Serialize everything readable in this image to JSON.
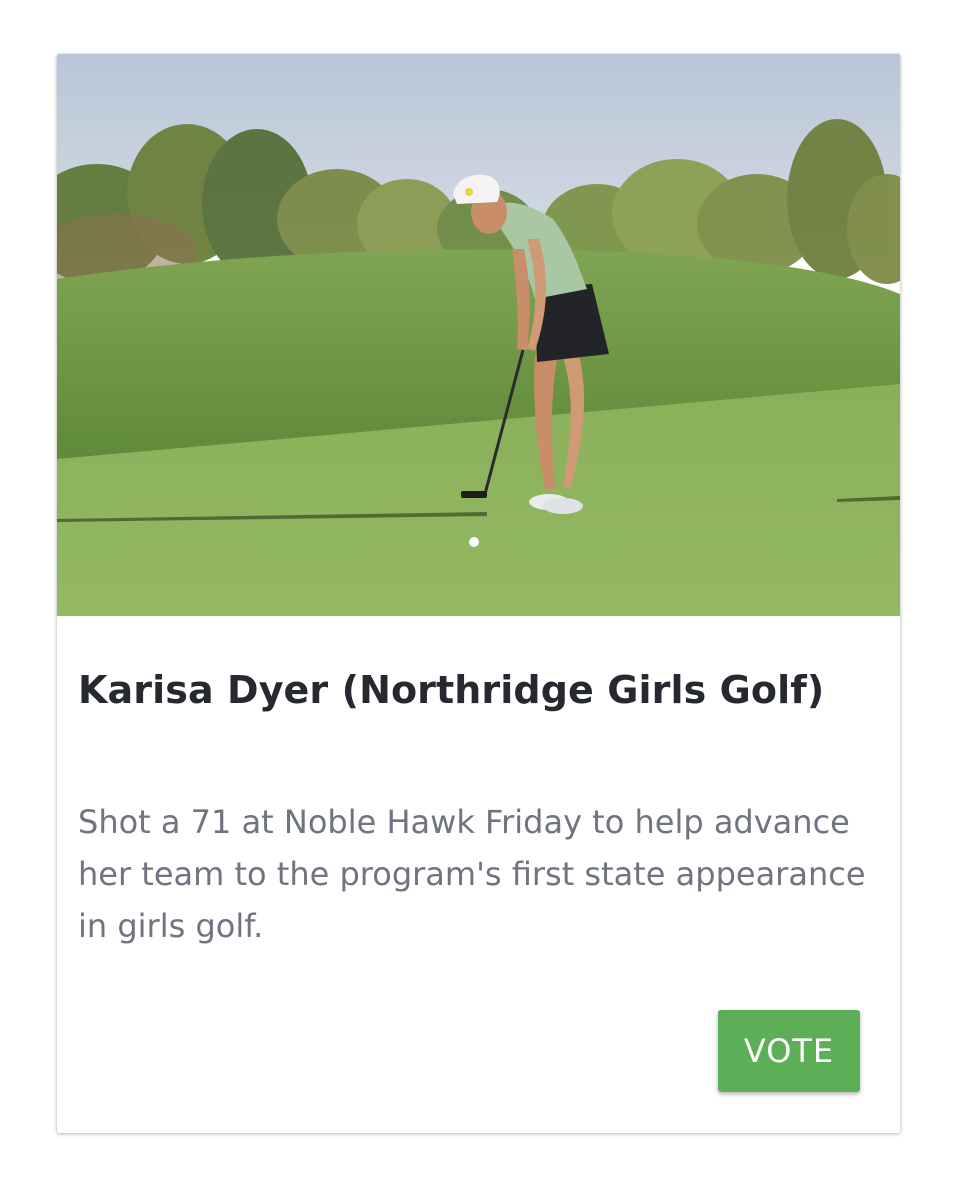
{
  "card": {
    "image": {
      "alt_icon": "golfer-photo"
    },
    "title": "Karisa Dyer (Northridge Girls Golf)",
    "description": "Shot a 71 at Noble Hawk Friday to help advance her team to the program's first state appearance in girls golf.",
    "vote_label": "VOTE"
  },
  "colors": {
    "title": "#262a30",
    "description": "#6f7480",
    "vote_button": "#5cae57",
    "vote_text": "#ffffff"
  }
}
